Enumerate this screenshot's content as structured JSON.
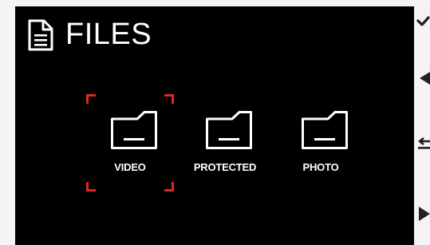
{
  "screen": {
    "title": "FILES",
    "title_icon": "document-icon"
  },
  "folders": [
    {
      "label": "VIDEO",
      "icon": "folder-icon",
      "selected": true
    },
    {
      "label": "PROTECTED",
      "icon": "folder-icon",
      "selected": false
    },
    {
      "label": "PHOTO",
      "icon": "folder-icon",
      "selected": false
    }
  ],
  "side_controls": [
    {
      "icon": "check-icon"
    },
    {
      "icon": "triangle-left-icon"
    },
    {
      "icon": "back-arrow-icon"
    },
    {
      "icon": "triangle-right-icon"
    }
  ],
  "colors": {
    "background": "#000000",
    "foreground": "#ffffff",
    "selection": "#e42521"
  }
}
